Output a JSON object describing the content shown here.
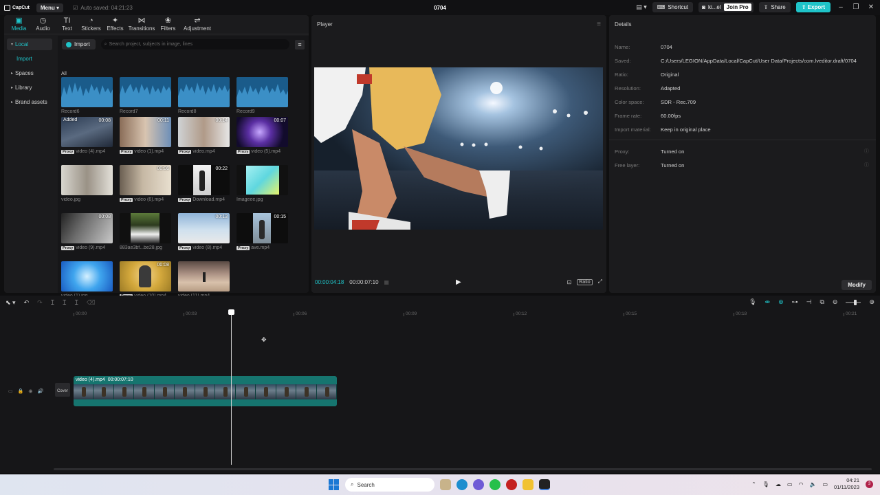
{
  "app": {
    "brand": "CapCut",
    "menu_label": "Menu",
    "autosave": "Auto saved: 04:21:23",
    "title": "0704",
    "shortcut_label": "Shortcut",
    "user_label": "ki...el",
    "join_pro_label": "Join Pro",
    "share_label": "Share",
    "export_label": "Export",
    "accent": "#1fc4c9"
  },
  "tabs": [
    {
      "label": "Media",
      "icon": "media-icon"
    },
    {
      "label": "Audio",
      "icon": "audio-icon"
    },
    {
      "label": "Text",
      "icon": "text-icon"
    },
    {
      "label": "Stickers",
      "icon": "stickers-icon"
    },
    {
      "label": "Effects",
      "icon": "effects-icon"
    },
    {
      "label": "Transitions",
      "icon": "transitions-icon"
    },
    {
      "label": "Filters",
      "icon": "filters-icon"
    },
    {
      "label": "Adjustment",
      "icon": "adjustment-icon"
    }
  ],
  "sidebar": {
    "items": [
      {
        "label": "Local"
      },
      {
        "label": "Import"
      },
      {
        "label": "Spaces"
      },
      {
        "label": "Library"
      },
      {
        "label": "Brand assets"
      }
    ]
  },
  "media": {
    "import_label": "Import",
    "search_placeholder": "Search project, subjects in image, lines",
    "all_label": "All",
    "proxy_badge": "Proxy",
    "added_badge": "Added",
    "items": [
      {
        "name": "Record6",
        "duration": "",
        "proxy": false
      },
      {
        "name": "Record7",
        "duration": "",
        "proxy": false
      },
      {
        "name": "Record8",
        "duration": "",
        "proxy": false
      },
      {
        "name": "Record9",
        "duration": "",
        "proxy": false
      },
      {
        "name": "video (4).mp4",
        "duration": "00:08",
        "proxy": true
      },
      {
        "name": "video (1).mp4",
        "duration": "00:11",
        "proxy": true
      },
      {
        "name": "video.mp4",
        "duration": "00:14",
        "proxy": true
      },
      {
        "name": "video (5).mp4",
        "duration": "00:07",
        "proxy": true
      },
      {
        "name": "video.jpg",
        "duration": "",
        "proxy": false
      },
      {
        "name": "video (6).mp4",
        "duration": "00:06",
        "proxy": true
      },
      {
        "name": "Download.mp4",
        "duration": "00:22",
        "proxy": true
      },
      {
        "name": "Imageee.jpg",
        "duration": "",
        "proxy": false
      },
      {
        "name": "video (9).mp4",
        "duration": "00:08",
        "proxy": true
      },
      {
        "name": "883ae3bf...be28.jpg",
        "duration": "",
        "proxy": false
      },
      {
        "name": "video (8).mp4",
        "duration": "00:13",
        "proxy": true
      },
      {
        "name": "ave.mp4",
        "duration": "00:15",
        "proxy": true
      },
      {
        "name": "video (1).jpg",
        "duration": "",
        "proxy": false
      },
      {
        "name": "video (10).mp4",
        "duration": "00:08",
        "proxy": true
      },
      {
        "name": "video (11).mp4",
        "duration": "",
        "proxy": false
      }
    ]
  },
  "player": {
    "title": "Player",
    "current_time": "00:00:04:18",
    "total_time": "00:00:07:10",
    "ratio_label": "Ratio"
  },
  "details": {
    "title": "Details",
    "rows": [
      {
        "label": "Name:",
        "value": "0704"
      },
      {
        "label": "Saved:",
        "value": "C:/Users/LEGION/AppData/Local/CapCut/User Data/Projects/com.lveditor.draft/0704"
      },
      {
        "label": "Ratio:",
        "value": "Original"
      },
      {
        "label": "Resolution:",
        "value": "Adapted"
      },
      {
        "label": "Color space:",
        "value": "SDR - Rec.709"
      },
      {
        "label": "Frame rate:",
        "value": "60.00fps"
      },
      {
        "label": "Import material:",
        "value": "Keep in original place"
      }
    ],
    "rows2": [
      {
        "label": "Proxy:",
        "value": "Turned on"
      },
      {
        "label": "Free layer:",
        "value": "Turned on"
      }
    ],
    "modify_label": "Modify"
  },
  "timeline": {
    "ticks": [
      "00:00",
      "00:03",
      "00:06",
      "00:09",
      "00:12",
      "00:15",
      "00:18",
      "00:21"
    ],
    "cover_label": "Cover",
    "clip_name": "video (4).mp4",
    "clip_duration": "00:00:07:10"
  },
  "taskbar": {
    "search_label": "Search",
    "time": "04:21",
    "date": "01/11/2023",
    "notifications": "3"
  }
}
